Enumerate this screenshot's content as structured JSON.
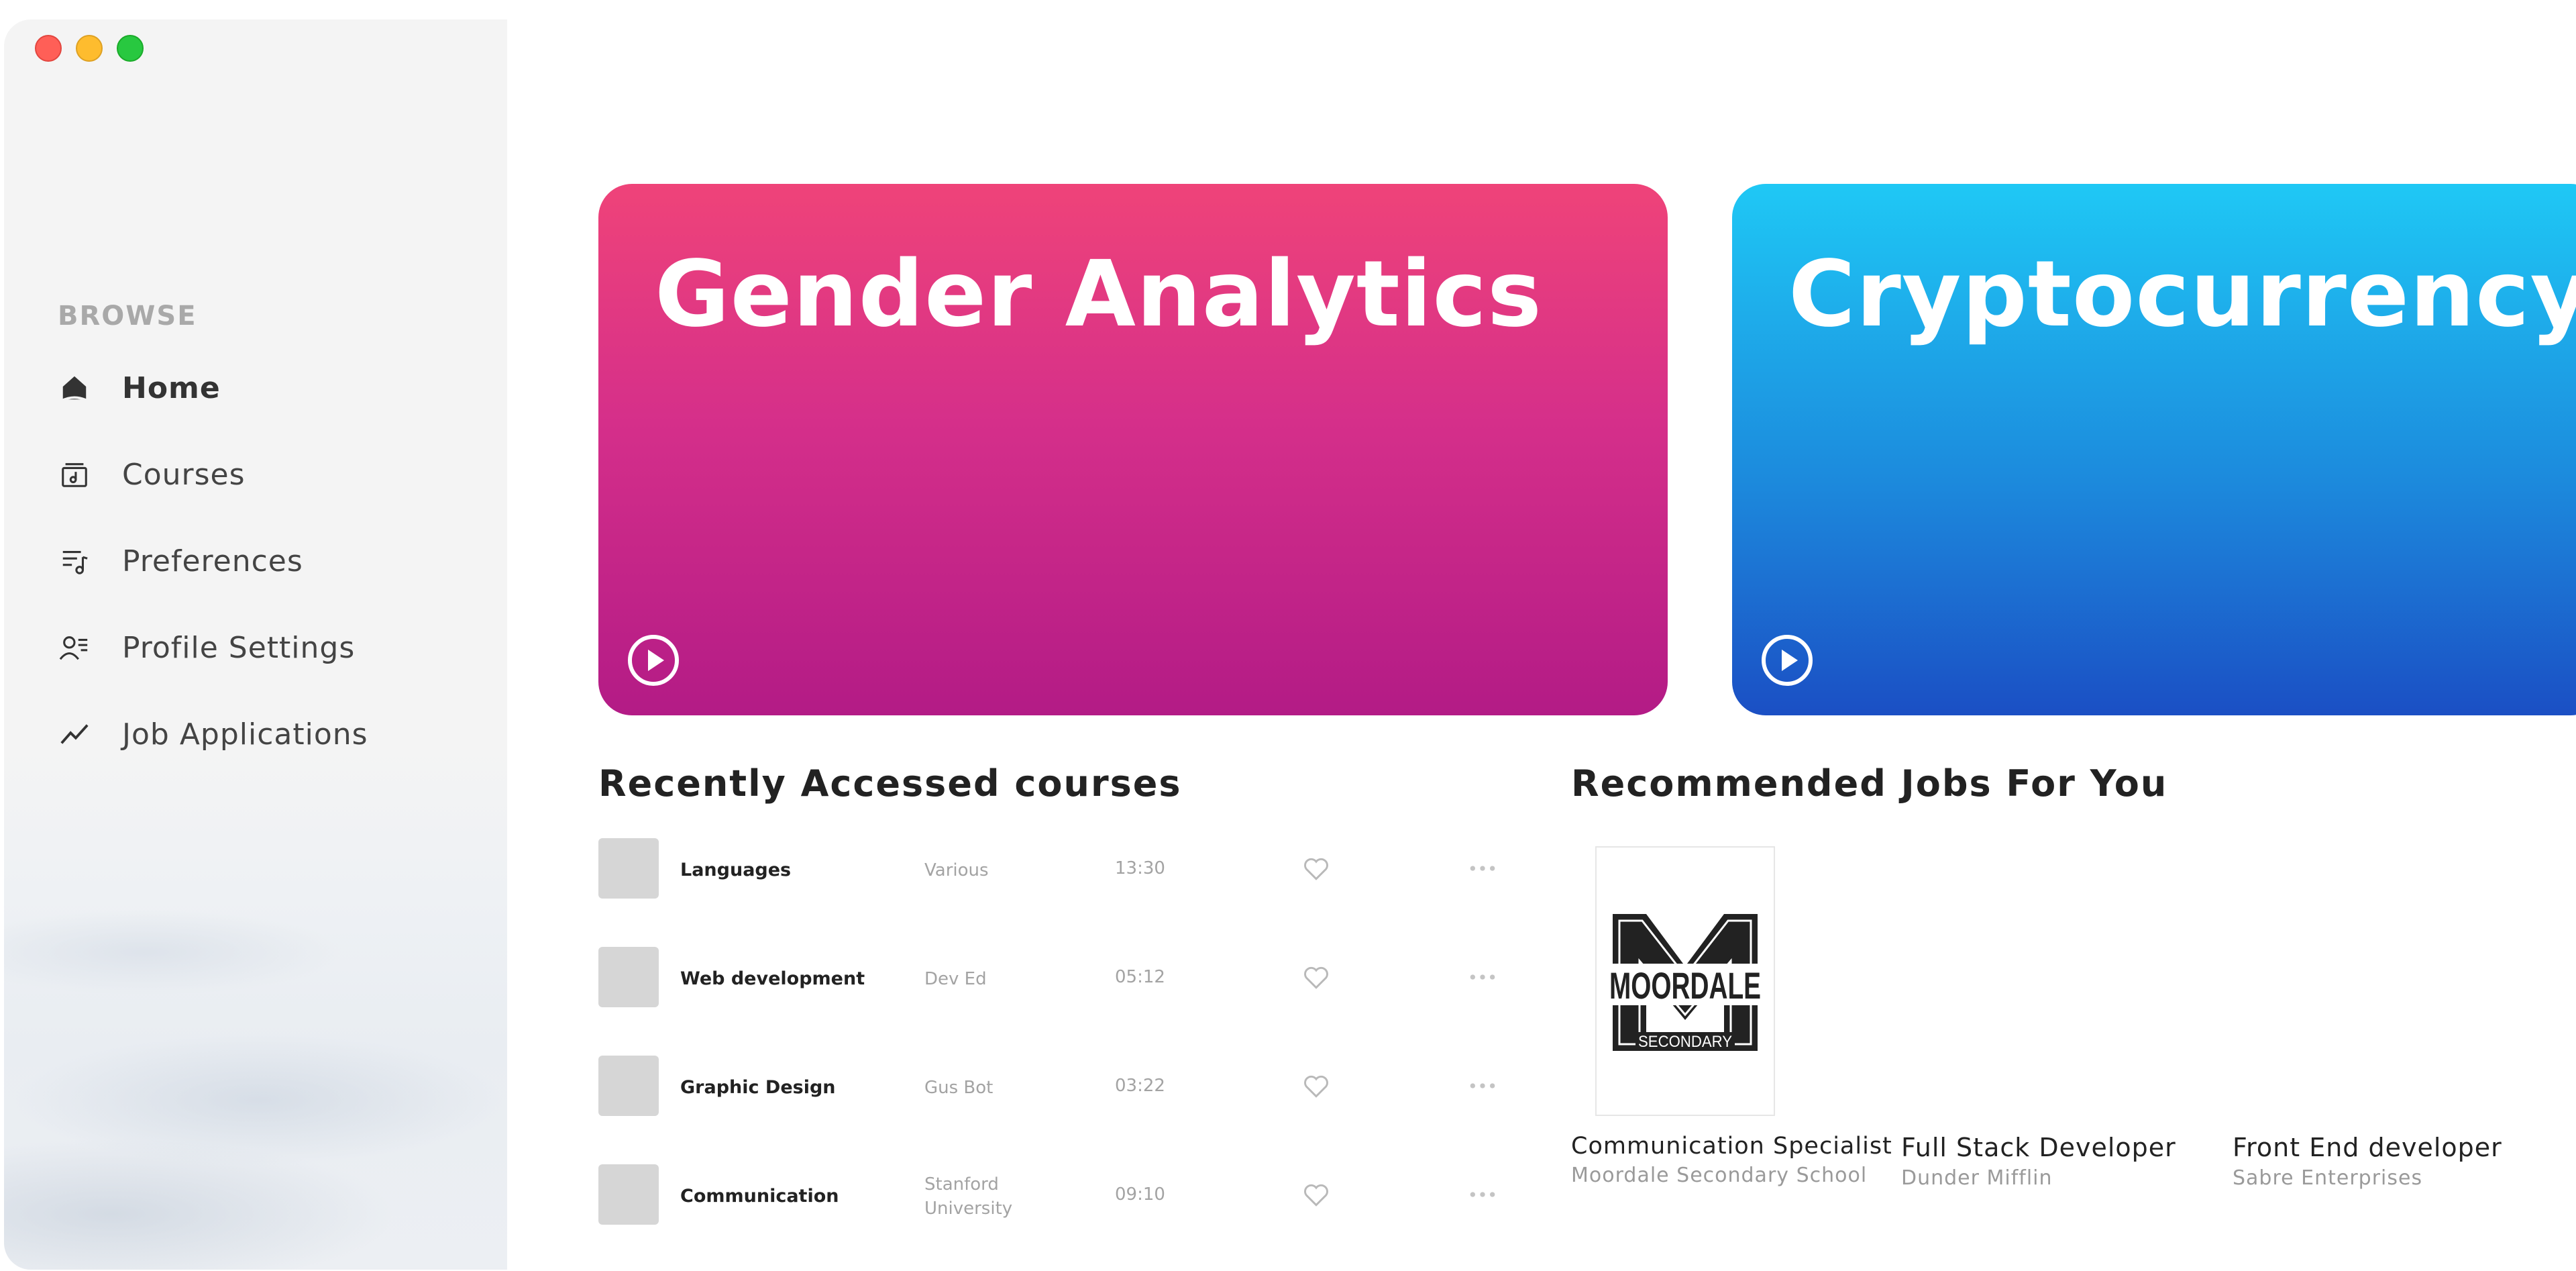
{
  "window": {
    "controls": [
      "close",
      "minimize",
      "zoom"
    ]
  },
  "sidebar": {
    "section_label": "BROWSE",
    "items": [
      {
        "label": "Home",
        "icon": "home-icon",
        "active": true
      },
      {
        "label": "Courses",
        "icon": "courses-icon",
        "active": false
      },
      {
        "label": "Preferences",
        "icon": "preferences-icon",
        "active": false
      },
      {
        "label": "Profile Settings",
        "icon": "profile-icon",
        "active": false
      },
      {
        "label": "Job Applications",
        "icon": "trend-icon",
        "active": false
      }
    ]
  },
  "featured": [
    {
      "title": "Gender Analytics",
      "color_top": "#ef4379",
      "color_bottom": "#b31b86"
    },
    {
      "title": "Cryptocurrency",
      "color_top": "#1fc8f5",
      "color_bottom": "#1b4fc4"
    }
  ],
  "recent": {
    "heading": "Recently Accessed courses",
    "courses": [
      {
        "name": "Languages",
        "author": "Various",
        "time": "13:30"
      },
      {
        "name": "Web development",
        "author": "Dev Ed",
        "time": "05:12"
      },
      {
        "name": "Graphic Design",
        "author": "Gus Bot",
        "time": "03:22"
      },
      {
        "name": "Communication",
        "author": "Stanford University",
        "time": "09:10"
      }
    ]
  },
  "jobs": {
    "heading": "Recommended Jobs For You",
    "logo": {
      "school": "MOORDALE",
      "sub": "SECONDARY"
    },
    "items": [
      {
        "title": "Communication Specialist",
        "company": "Moordale Secondary School"
      },
      {
        "title": "Full Stack Developer",
        "company": "Dunder Mifflin"
      },
      {
        "title": "Front End developer",
        "company": "Sabre Enterprises"
      }
    ]
  }
}
